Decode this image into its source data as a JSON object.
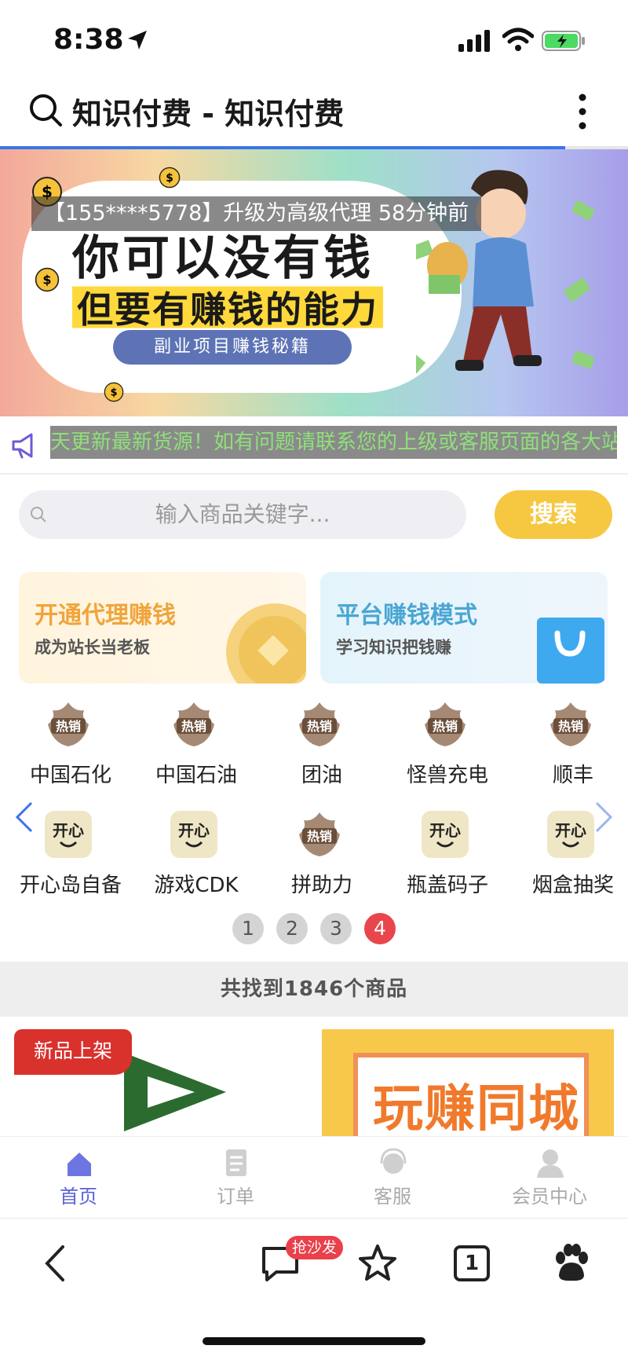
{
  "status": {
    "time": "8:38",
    "battery_color": "#4cd964"
  },
  "header": {
    "title": "知识付费 - 知识付费",
    "load_progress": 0.9
  },
  "banner": {
    "notice": "【155****5778】升级为高级代理 58分钟前",
    "headline": "你可以没有钱",
    "subheadline": "但要有赚钱的能力",
    "pill": "副业项目赚钱秘籍"
  },
  "marquee": {
    "text": "天更新最新货源！如有问题请联系您的上级或客服页面的各大站"
  },
  "search": {
    "placeholder": "输入商品关键字...",
    "button": "搜索"
  },
  "promo": {
    "left": {
      "title": "开通代理赚钱",
      "subtitle": "成为站长当老板"
    },
    "right": {
      "title": "平台赚钱模式",
      "subtitle": "学习知识把钱赚"
    }
  },
  "categories": [
    {
      "label": "中国石化",
      "icon": "hot-sale-icon"
    },
    {
      "label": "中国石油",
      "icon": "hot-sale-icon"
    },
    {
      "label": "团油",
      "icon": "hot-sale-icon"
    },
    {
      "label": "怪兽充电",
      "icon": "hot-sale-icon"
    },
    {
      "label": "顺丰",
      "icon": "hot-sale-icon"
    },
    {
      "label": "开心岛自备",
      "icon": "kaixin-icon"
    },
    {
      "label": "游戏CDK",
      "icon": "kaixin-icon"
    },
    {
      "label": "拼助力",
      "icon": "hot-sale-icon"
    },
    {
      "label": "瓶盖码子",
      "icon": "kaixin-icon"
    },
    {
      "label": "烟盒抽奖",
      "icon": "kaixin-icon"
    }
  ],
  "icon_text": {
    "hot": "热销",
    "kaixin": "开心"
  },
  "pages": [
    "1",
    "2",
    "3",
    "4"
  ],
  "active_page": "4",
  "found": "共找到1846个商品",
  "products": {
    "p1_tag": "新品上架",
    "p2_sign": "玩赚同城"
  },
  "tabs": [
    {
      "label": "首页",
      "icon": "home-icon",
      "active": true
    },
    {
      "label": "订单",
      "icon": "order-icon",
      "active": false
    },
    {
      "label": "客服",
      "icon": "service-icon",
      "active": false
    },
    {
      "label": "会员中心",
      "icon": "member-icon",
      "active": false
    }
  ],
  "browser": {
    "badge": "抢沙发",
    "tab_count": "1"
  }
}
